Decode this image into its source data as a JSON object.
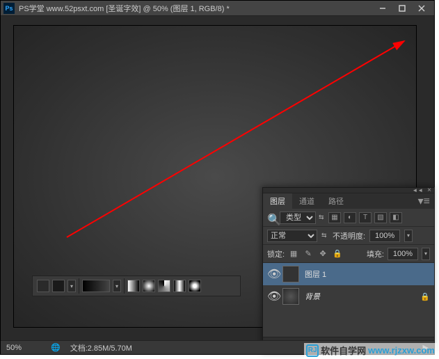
{
  "window": {
    "title": "PS学堂 www.52psxt.com [圣诞字效] @ 50% (图层 1, RGB/8) *"
  },
  "status": {
    "zoom": "50%",
    "doc_info": "文档:2.85M/5.70M"
  },
  "layers_panel": {
    "tabs": [
      "图层",
      "通道",
      "路径"
    ],
    "filter_label": "类型",
    "blend_mode": "正常",
    "opacity_label": "不透明度:",
    "opacity_value": "100%",
    "lock_label": "锁定:",
    "fill_label": "填充:",
    "fill_value": "100%",
    "layers": [
      {
        "name": "图层 1",
        "visible": true,
        "selected": true,
        "locked": false
      },
      {
        "name": "背景",
        "visible": true,
        "selected": false,
        "locked": true
      }
    ]
  },
  "watermark": {
    "text_cn": "软件自学网",
    "url": "www.rjzxw.com"
  }
}
